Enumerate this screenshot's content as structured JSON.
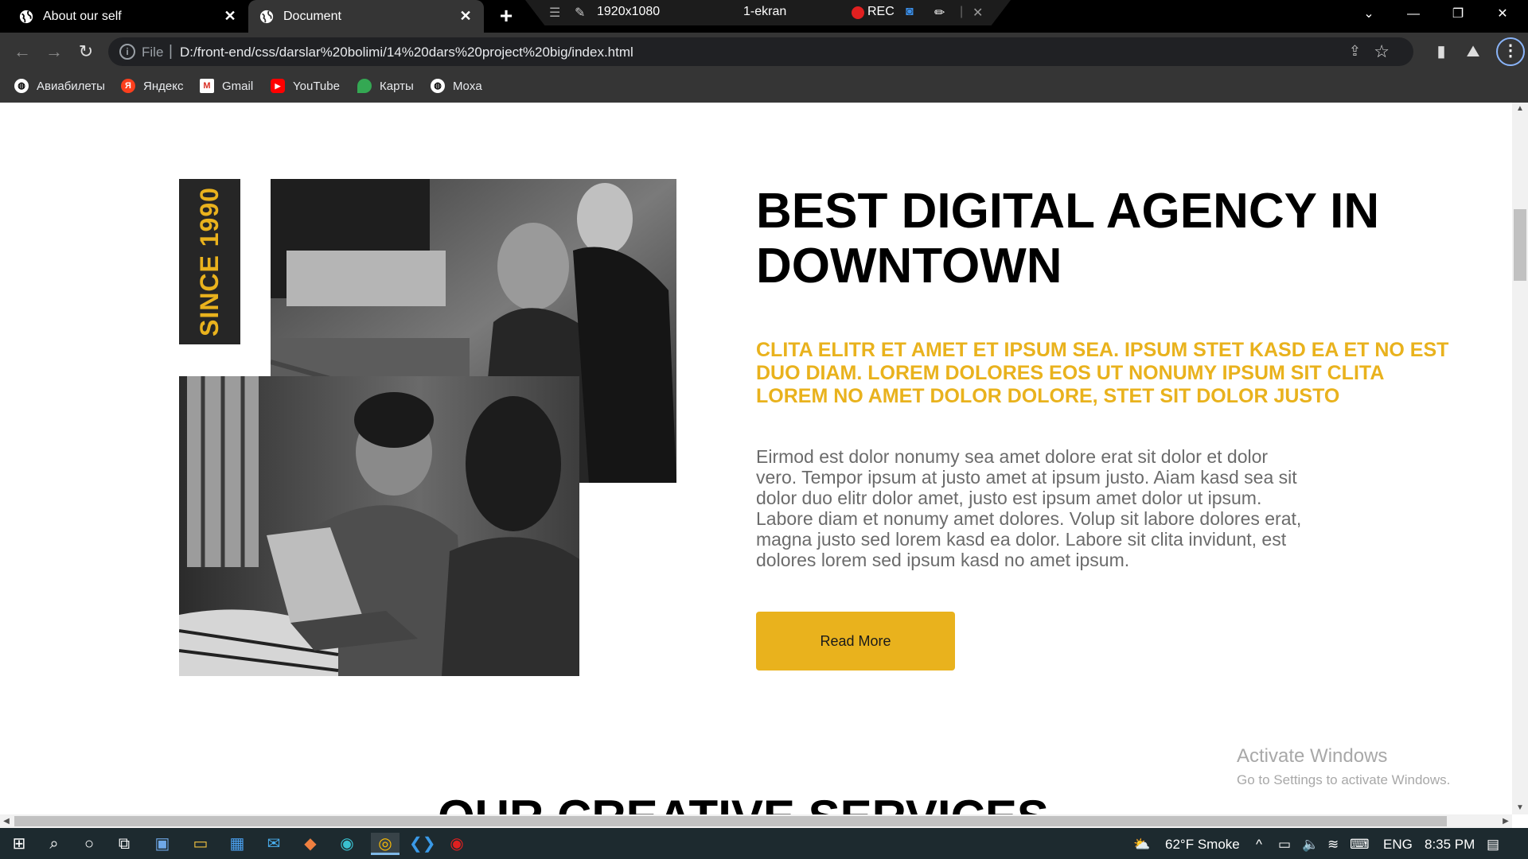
{
  "browser": {
    "tabs": [
      {
        "title": "About our self",
        "active": false
      },
      {
        "title": "Document",
        "active": true
      }
    ],
    "address": {
      "scheme_label": "File",
      "url": "D:/front-end/css/darslar%20bolimi/14%20dars%20project%20big/index.html"
    },
    "bookmarks": [
      {
        "label": "Авиабилеты",
        "icon": "globe-icon"
      },
      {
        "label": "Яндекс",
        "icon": "yandex-icon"
      },
      {
        "label": "Gmail",
        "icon": "gmail-icon"
      },
      {
        "label": "YouTube",
        "icon": "youtube-icon"
      },
      {
        "label": "Карты",
        "icon": "maps-pin-icon"
      },
      {
        "label": "Moxa",
        "icon": "globe-icon"
      }
    ]
  },
  "recorder": {
    "resolution": "1920x1080",
    "screen": "1-ekran",
    "rec_label": "REC"
  },
  "page": {
    "since_label": "SINCE 1990",
    "heading": "BEST DIGITAL AGENCY IN DOWNTOWN",
    "subheading": "CLITA ELITR ET AMET ET IPSUM SEA. IPSUM STET KASD EA ET NO EST DUO DIAM. LOREM DOLORES EOS UT NONUMY IPSUM SIT CLITA LOREM NO AMET DOLOR DOLORE, STET SIT DOLOR JUSTO",
    "body": "Eirmod est dolor nonumy sea amet dolore erat sit dolor et dolor vero. Tempor ipsum at justo amet at ipsum justo. Aiam kasd sea sit dolor duo elitr dolor amet, justo est ipsum amet dolor ut ipsum. Labore diam et nonumy amet dolores. Volup sit labore dolores erat, magna justo sed lorem kasd ea dolor. Labore sit clita invidunt, est dolores lorem sed ipsum kasd no amet ipsum.",
    "button_label": "Read More",
    "next_section_title": "OUR CREATIVE SERVICES",
    "accent_color": "#e9b21d"
  },
  "watermark": {
    "line1": "Activate Windows",
    "line2": "Go to Settings to activate Windows."
  },
  "taskbar": {
    "weather": "62°F  Smoke",
    "language": "ENG",
    "time": "8:35 PM"
  }
}
